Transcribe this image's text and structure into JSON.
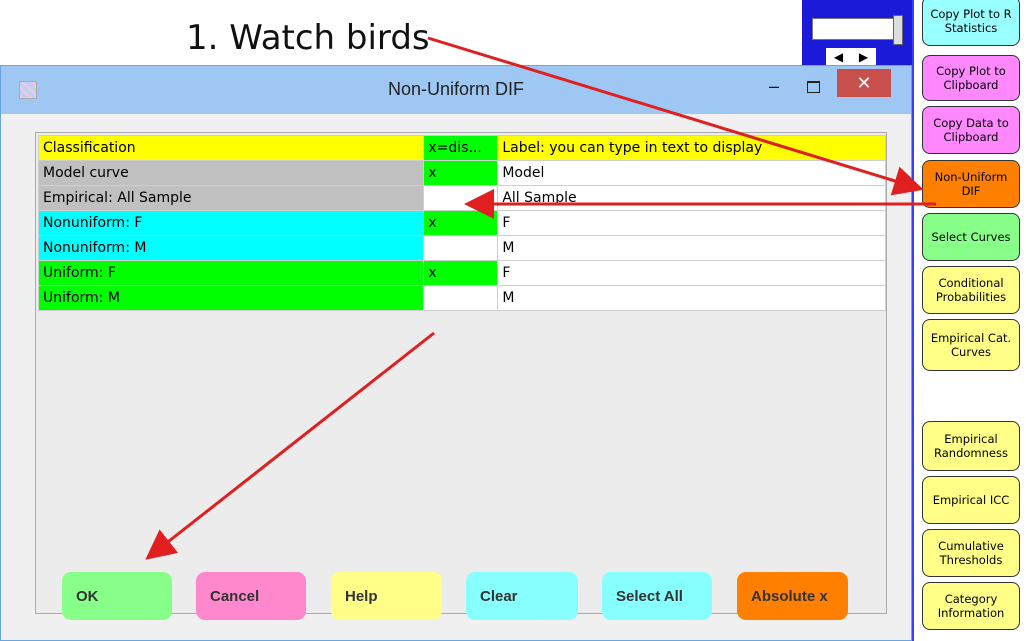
{
  "annotation": {
    "title": "1. Watch birds"
  },
  "top_widget": {
    "left_arrow": "◀",
    "right_arrow": "▶"
  },
  "right_buttons": [
    {
      "label": "Copy Plot to R Statistics",
      "color": "#99ffff"
    },
    {
      "label": "Copy Plot to Clipboard",
      "color": "#ff88ff"
    },
    {
      "label": "Copy Data to Clipboard",
      "color": "#ff88ff"
    },
    {
      "label": "Non-Uniform DIF",
      "color": "#ff8000"
    },
    {
      "label": "Select Curves",
      "color": "#88ff88"
    },
    {
      "label": "Conditional Probabilities",
      "color": "#ffff88"
    },
    {
      "label": "Empirical Cat. Curves",
      "color": "#ffff88"
    },
    {
      "label": "Empirical Randomness",
      "color": "#ffff88"
    },
    {
      "label": "Empirical ICC",
      "color": "#ffff88"
    },
    {
      "label": "Cumulative Thresholds",
      "color": "#ffff88"
    },
    {
      "label": "Category Information",
      "color": "#ffff88"
    }
  ],
  "dialog": {
    "title": "Non-Uniform DIF",
    "min_symbol": "‒",
    "close_symbol": "✕",
    "table": {
      "headers": [
        "Classification",
        "x=dis...",
        "Label: you can type in text to display"
      ],
      "rows": [
        {
          "classification": "Model curve",
          "display": "x",
          "label": "Model",
          "color": "#c0c0c0"
        },
        {
          "classification": "Empirical: All Sample",
          "display": "",
          "label": "All Sample",
          "color": "#c0c0c0"
        },
        {
          "classification": "Nonuniform: F",
          "display": "x",
          "label": "F",
          "color": "#00ffff"
        },
        {
          "classification": "Nonuniform: M",
          "display": "",
          "label": "M",
          "color": "#00ffff"
        },
        {
          "classification": "Uniform: F",
          "display": "x",
          "label": "F",
          "color": "#00ff00"
        },
        {
          "classification": "Uniform: M",
          "display": "",
          "label": "M",
          "color": "#00ff00"
        }
      ]
    },
    "buttons": [
      {
        "label": "OK",
        "color": "#88ff88"
      },
      {
        "label": "Cancel",
        "color": "#ff88cc"
      },
      {
        "label": "Help",
        "color": "#ffff88"
      },
      {
        "label": "Clear",
        "color": "#88ffff"
      },
      {
        "label": "Select All",
        "color": "#88ffff"
      },
      {
        "label": "Absolute x",
        "color": "#ff8000"
      }
    ]
  },
  "colors": {
    "header_bg": "#ffff00",
    "display_bg": "#00ff00",
    "arrow": "#e02020"
  }
}
